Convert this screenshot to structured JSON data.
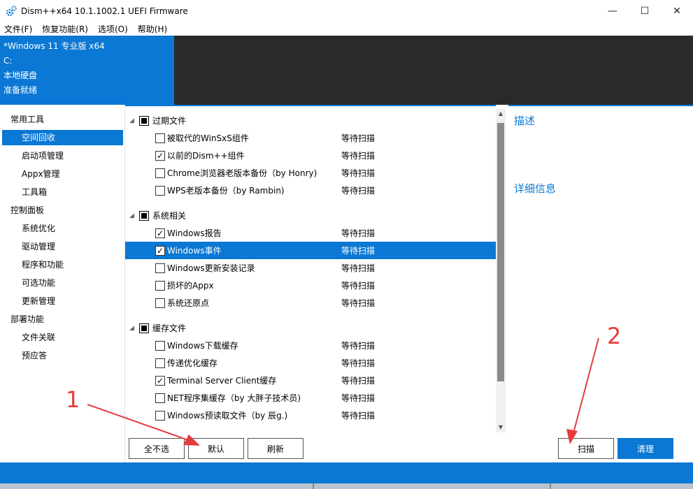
{
  "window": {
    "title": "Dism++x64 10.1.1002.1 UEFI Firmware",
    "controls": {
      "minimize": "—",
      "maximize": "☐",
      "close": "✕"
    }
  },
  "menu": [
    "文件(F)",
    "恢复功能(R)",
    "选项(O)",
    "帮助(H)"
  ],
  "info": [
    "*Windows 11 专业版 x64",
    "C:",
    "本地硬盘",
    "准备就绪"
  ],
  "sidebar": {
    "groups": [
      {
        "label": "常用工具",
        "items": [
          "空间回收",
          "启动项管理",
          "Appx管理",
          "工具箱"
        ]
      },
      {
        "label": "控制面板",
        "items": [
          "系统优化",
          "驱动管理",
          "程序和功能",
          "可选功能",
          "更新管理"
        ]
      },
      {
        "label": "部署功能",
        "items": [
          "文件关联",
          "预应答"
        ]
      }
    ],
    "active": "空间回收"
  },
  "list": {
    "groups": [
      {
        "label": "过期文件",
        "items": [
          {
            "name": "被取代的WinSxS组件",
            "status": "等待扫描",
            "checked": false
          },
          {
            "name": "以前的Dism++组件",
            "status": "等待扫描",
            "checked": true
          },
          {
            "name": "Chrome浏览器老版本备份（by Honry)",
            "status": "等待扫描",
            "checked": false
          },
          {
            "name": "WPS老版本备份（by Rambin)",
            "status": "等待扫描",
            "checked": false
          }
        ]
      },
      {
        "label": "系统相关",
        "items": [
          {
            "name": "Windows报告",
            "status": "等待扫描",
            "checked": true
          },
          {
            "name": "Windows事件",
            "status": "等待扫描",
            "checked": true,
            "selected": true
          },
          {
            "name": "Windows更新安装记录",
            "status": "等待扫描",
            "checked": false
          },
          {
            "name": "损坏的Appx",
            "status": "等待扫描",
            "checked": false
          },
          {
            "name": "系统还原点",
            "status": "等待扫描",
            "checked": false
          }
        ]
      },
      {
        "label": "缓存文件",
        "items": [
          {
            "name": "Windows下载缓存",
            "status": "等待扫描",
            "checked": false
          },
          {
            "name": "传递优化缓存",
            "status": "等待扫描",
            "checked": false
          },
          {
            "name": "Terminal Server Client缓存",
            "status": "等待扫描",
            "checked": true
          },
          {
            "name": "NET程序集缓存（by 大胖子技术员)",
            "status": "等待扫描",
            "checked": false
          },
          {
            "name": "Windows预读取文件（by 辰g.)",
            "status": "等待扫描",
            "checked": false
          }
        ]
      }
    ]
  },
  "right_panel": {
    "description": "描述",
    "details": "详细信息"
  },
  "buttons": {
    "deselect_all": "全不选",
    "default": "默认",
    "refresh": "刷新",
    "scan": "扫描",
    "clean": "清理"
  },
  "annotations": {
    "label1": "1",
    "label2": "2",
    "color": "#e63b3b"
  },
  "colors": {
    "accent": "#0a78d4",
    "dark": "#2a2a2a"
  }
}
